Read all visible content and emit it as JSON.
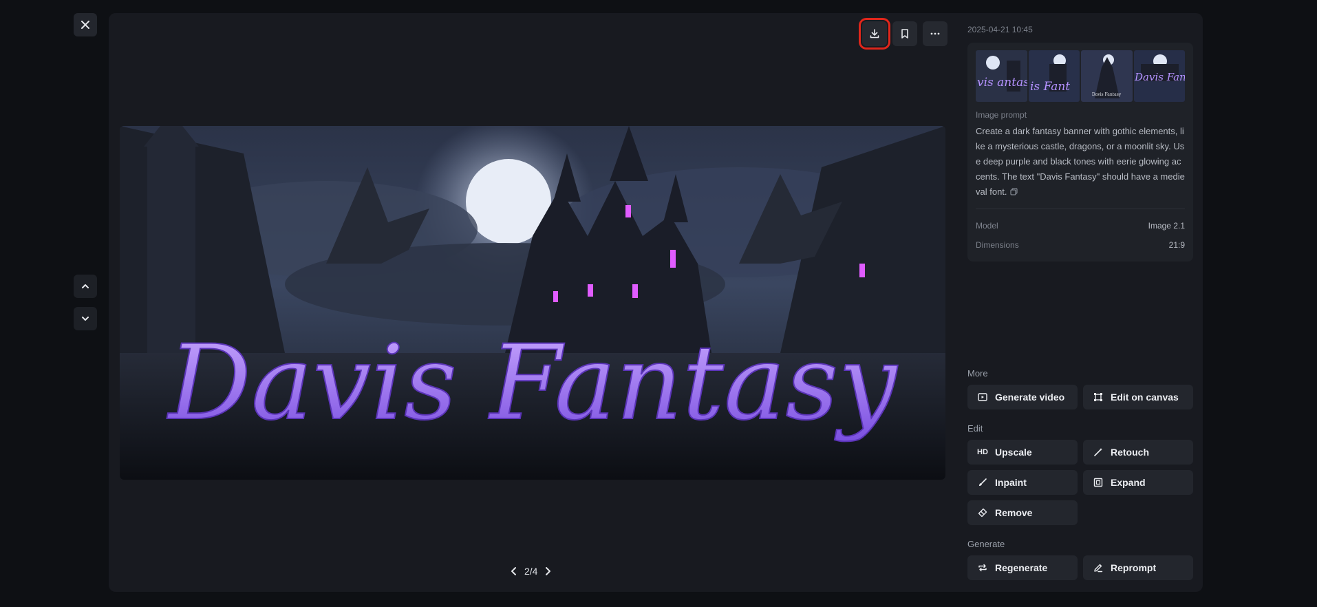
{
  "viewer": {
    "pagination": "2/4",
    "main_image_text": "Davis Fantasy"
  },
  "toolbar": {
    "download_icon": "download-icon",
    "bookmark_icon": "bookmark-icon",
    "more_icon": "more-horizontal-icon"
  },
  "sidebar": {
    "timestamp": "2025-04-21 10:45",
    "thumbnails": [
      {
        "caption": "vis antasy"
      },
      {
        "caption": "is Fant"
      },
      {
        "caption": "Davis Fantasy"
      },
      {
        "caption": "Davis Fanta"
      }
    ],
    "prompt_label": "Image prompt",
    "prompt_text": "Create a dark fantasy banner with gothic elements, like a mysterious castle, dragons, or a moonlit sky. Use deep purple and black tones with eerie glowing accents. The text \"Davis Fantasy\" should have a medieval font.",
    "model_label": "Model",
    "model_value": "Image 2.1",
    "dimensions_label": "Dimensions",
    "dimensions_value": "21:9"
  },
  "more": {
    "title": "More",
    "generate_video": "Generate video",
    "edit_on_canvas": "Edit on canvas"
  },
  "edit": {
    "title": "Edit",
    "upscale": "Upscale",
    "upscale_icon_text": "HD",
    "retouch": "Retouch",
    "inpaint": "Inpaint",
    "expand": "Expand",
    "remove": "Remove"
  },
  "generate": {
    "title": "Generate",
    "regenerate": "Regenerate",
    "reprompt": "Reprompt"
  },
  "colors": {
    "background": "#0e1014",
    "panel": "#181a20",
    "highlight": "#e0261b",
    "accent_purple": "#9a6cf0"
  }
}
